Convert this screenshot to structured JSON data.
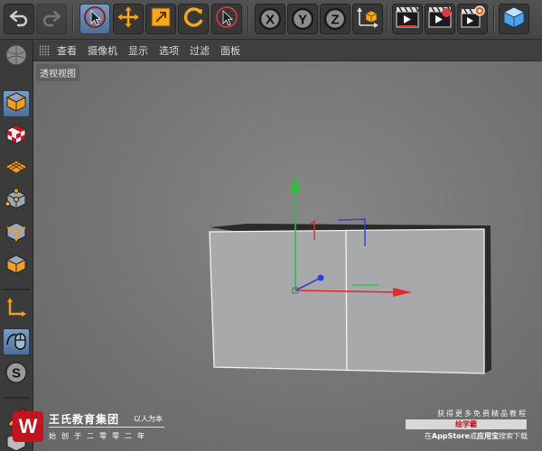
{
  "toolbar": {
    "undo_icon": "undo-icon",
    "redo_icon": "redo-icon",
    "tools": [
      "live-selection-icon",
      "move-icon",
      "scale-icon",
      "rotate-icon",
      "recent-tool-icon"
    ],
    "axis_locks": [
      "X",
      "Y",
      "Z"
    ],
    "coordinate_icon": "world-coordinate-icon",
    "render_icons": [
      "render-view-icon",
      "render-picture-viewer-icon",
      "render-settings-icon"
    ],
    "cube_icon": "add-cube-icon"
  },
  "menubar": {
    "items": [
      "查看",
      "摄像机",
      "显示",
      "选项",
      "过滤",
      "面板"
    ]
  },
  "leftbar": {
    "items": [
      "model-mode-icon",
      "texture-mode-icon",
      "workplane-icon",
      "points-mode-icon",
      "edges-mode-icon",
      "polygons-mode-icon",
      "axis-mode-icon",
      "tweak-mode-icon",
      "snapping-icon",
      "paint-icon"
    ]
  },
  "viewport": {
    "label": "透视视图"
  },
  "watermark": {
    "logo": "W",
    "brand": "王氏教育集团",
    "tagline": "以人为本",
    "sub": "始创于二零零二年",
    "right_line1": "获得更多免费精品教程",
    "right_line2": "绘学霸",
    "right_line3_prefix": "在",
    "right_line3_store": "AppStore",
    "right_line3_mid": "或",
    "right_line3_app": "应用宝",
    "right_line3_suffix": "搜索下载"
  },
  "colors": {
    "axis_x": "#e8282a",
    "axis_y": "#26c23a",
    "axis_z": "#2f3fd8",
    "select_blue": "#5a7ca6",
    "orange": "#f0a020",
    "brand_red": "#c0141e"
  }
}
